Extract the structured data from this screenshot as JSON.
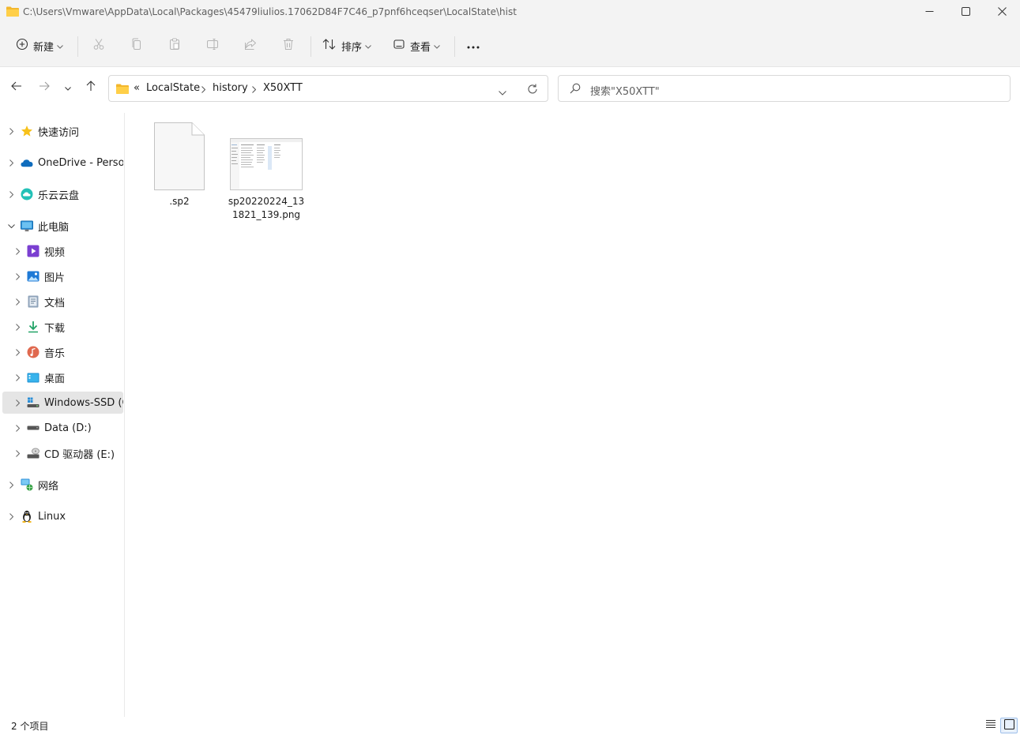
{
  "window": {
    "title_path": "C:\\Users\\Vmware\\AppData\\Local\\Packages\\45479liulios.17062D84F7C46_p7pnf6hceqser\\LocalState\\hist",
    "controls": [
      "minimize-icon",
      "maximize-icon",
      "close-icon"
    ]
  },
  "toolbar": {
    "new_label": "新建",
    "sort_label": "排序",
    "view_label": "查看",
    "more_label": "···",
    "icons": [
      "cut-icon",
      "copy-icon",
      "paste-icon",
      "rename-icon",
      "share-icon",
      "delete-icon"
    ]
  },
  "address": {
    "overflow": "«",
    "crumbs": [
      "LocalState",
      "history",
      "X50XTT"
    ]
  },
  "search": {
    "placeholder": "搜索\"X50XTT\""
  },
  "sidebar": {
    "items": [
      {
        "label": "快速访问",
        "icon": "star-icon"
      },
      {
        "label": "OneDrive - Personal",
        "icon": "onedrive-cloud-icon"
      },
      {
        "label": "乐云云盘",
        "icon": "cloud-drive-icon"
      },
      {
        "label": "此电脑",
        "icon": "pc-monitor-icon"
      },
      {
        "label": "视频",
        "icon": "video-icon"
      },
      {
        "label": "图片",
        "icon": "pictures-icon"
      },
      {
        "label": "文档",
        "icon": "documents-icon"
      },
      {
        "label": "下载",
        "icon": "download-icon"
      },
      {
        "label": "音乐",
        "icon": "music-icon"
      },
      {
        "label": "桌面",
        "icon": "desktop-icon"
      },
      {
        "label": "Windows-SSD (C:)",
        "icon": "windows-drive-icon"
      },
      {
        "label": "Data (D:)",
        "icon": "drive-icon"
      },
      {
        "label": "CD 驱动器 (E:)",
        "icon": "cd-drive-icon"
      },
      {
        "label": "网络",
        "icon": "network-icon"
      },
      {
        "label": "Linux",
        "icon": "linux-penguin-icon"
      }
    ]
  },
  "files": [
    {
      "name": ".sp2",
      "icon": "blank-file-icon"
    },
    {
      "name": "sp20220224_131821_139.png",
      "icon": "image-thumbnail"
    }
  ],
  "status": {
    "item_count": "2 个项目"
  }
}
